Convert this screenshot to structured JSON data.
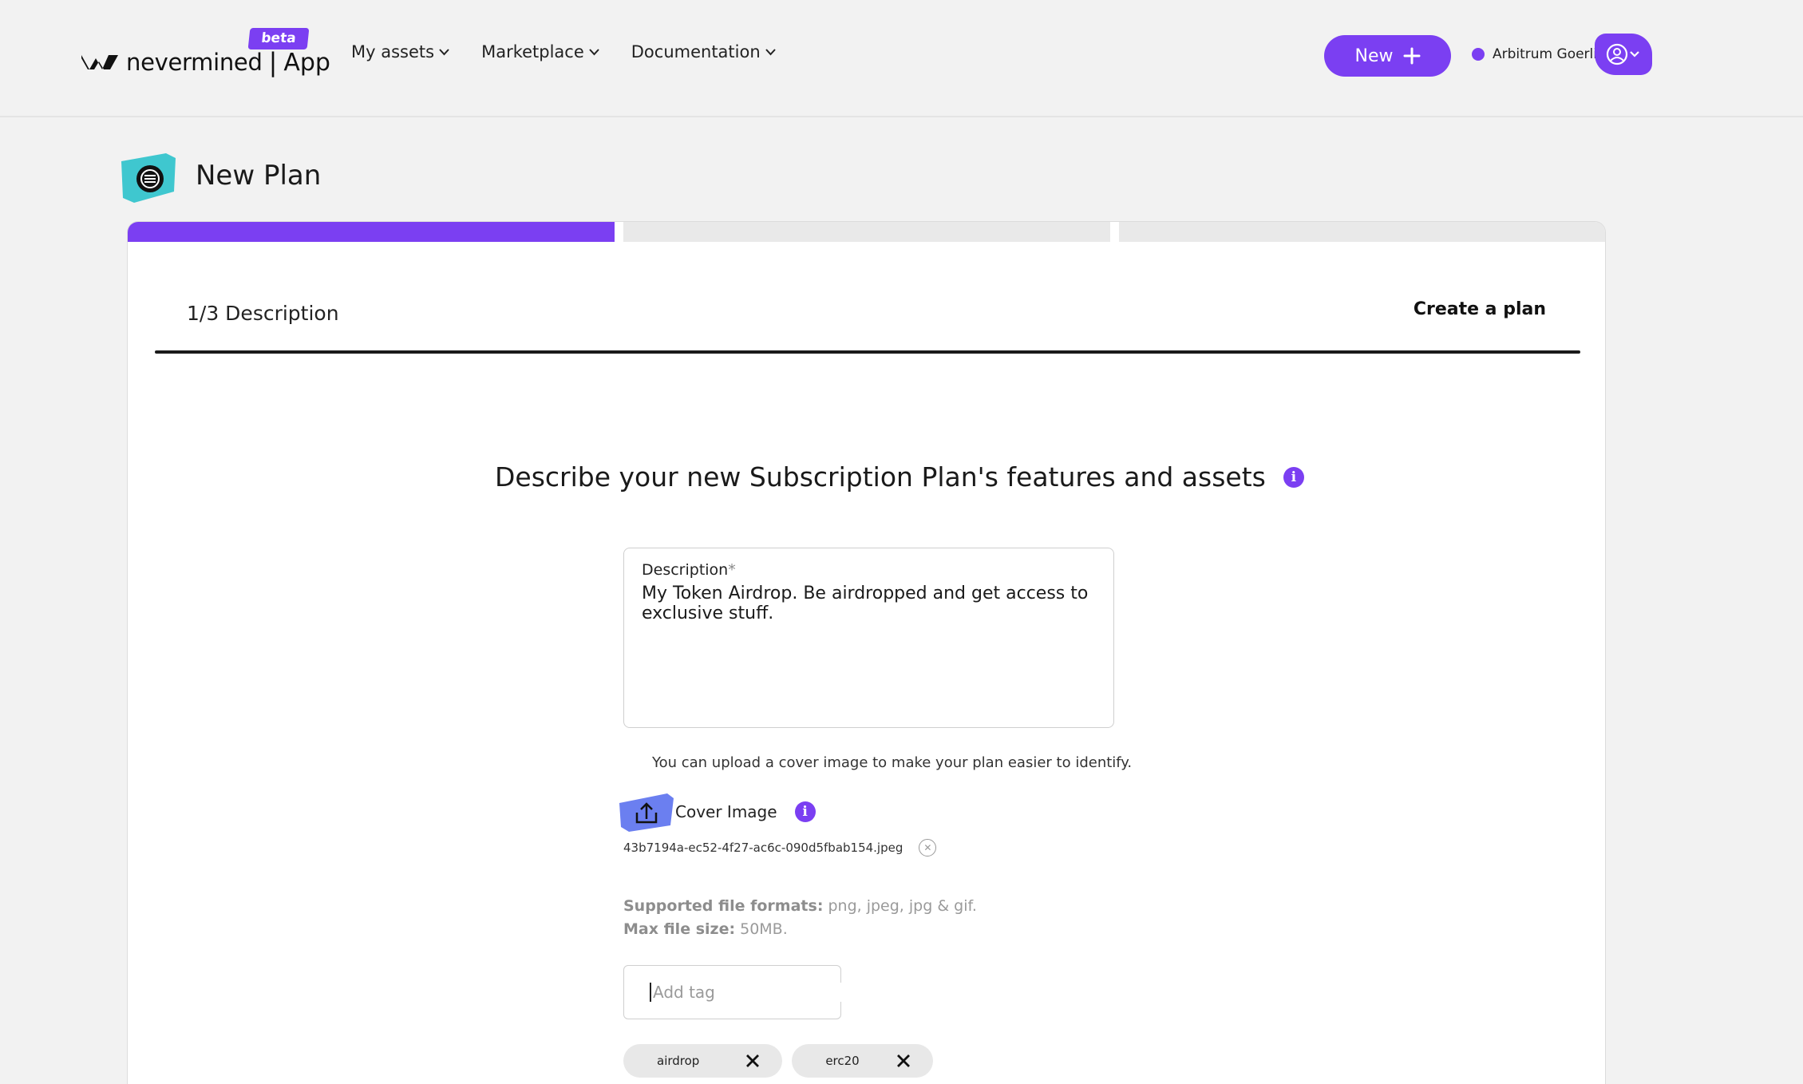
{
  "header": {
    "logo_text": "nevermined",
    "logo_sep": "|",
    "logo_app": "App",
    "beta_badge": "beta",
    "nav": [
      {
        "label": "My assets"
      },
      {
        "label": "Marketplace"
      },
      {
        "label": "Documentation"
      }
    ],
    "new_button": "New",
    "network": "Arbitrum Goerli",
    "accent_color": "#7b3ff2"
  },
  "page": {
    "title": "New Plan"
  },
  "wizard": {
    "progress": 0.333,
    "step_label": "1/3 Description",
    "step_action": "Create a plan",
    "heading": "Describe your new Subscription Plan's features and assets",
    "description": {
      "label": "Description",
      "required_mark": "*",
      "value": "My Token Airdrop. Be airdropped and get access to exclusive stuff."
    },
    "upload_hint": "You can upload a cover image to make your plan easier to identify.",
    "cover_label": "Cover Image",
    "file_name": "43b7194a-ec52-4f27-ac6c-090d5fbab154.jpeg",
    "formats_label": "Supported file formats:",
    "formats_value": "png, jpeg, jpg & gif.",
    "size_label": "Max file size:",
    "size_value": "50MB.",
    "tag_placeholder": "Add tag",
    "tags": [
      "airdrop",
      "erc20"
    ]
  }
}
